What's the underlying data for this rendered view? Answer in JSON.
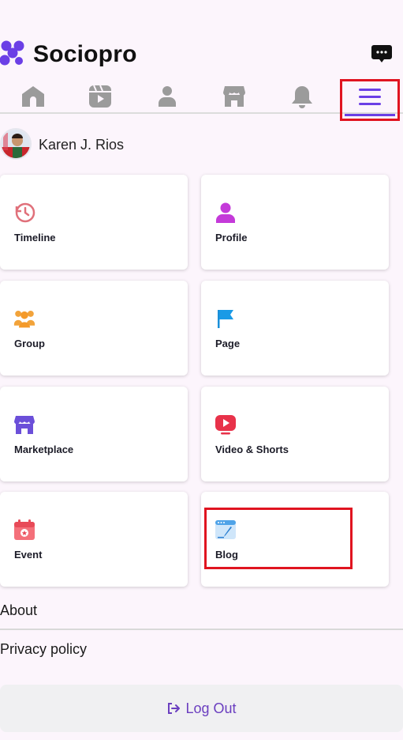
{
  "app": {
    "title": "Sociopro"
  },
  "nav": {
    "items": [
      {
        "icon": "home-icon"
      },
      {
        "icon": "video-icon"
      },
      {
        "icon": "profile-icon"
      },
      {
        "icon": "marketplace-icon"
      },
      {
        "icon": "bell-icon"
      },
      {
        "icon": "menu-icon",
        "active": true
      }
    ]
  },
  "user": {
    "name": "Karen J. Rios"
  },
  "menu": {
    "cards": [
      {
        "label": "Timeline",
        "icon": "timeline-icon"
      },
      {
        "label": "Profile",
        "icon": "profile-icon"
      },
      {
        "label": "Group",
        "icon": "group-icon"
      },
      {
        "label": "Page",
        "icon": "flag-icon"
      },
      {
        "label": "Marketplace",
        "icon": "store-icon"
      },
      {
        "label": "Video & Shorts",
        "icon": "play-icon"
      },
      {
        "label": "Event",
        "icon": "calendar-icon"
      },
      {
        "label": "Blog",
        "icon": "blog-icon"
      }
    ]
  },
  "links": {
    "about": "About",
    "privacy": "Privacy policy"
  },
  "logout": {
    "label": "Log Out"
  },
  "colors": {
    "accent": "#6b3fe6",
    "highlight": "#e01420",
    "background": "#fcf5fc"
  }
}
